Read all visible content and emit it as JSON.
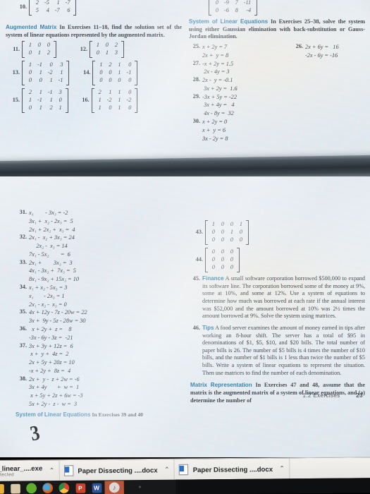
{
  "photo": {
    "description": "photo of a monitor showing a linear algebra textbook page"
  },
  "textbook": {
    "running_head": "1.2   Exercises",
    "page_number": "23",
    "top_matrix_left": {
      "number": "10.",
      "rows": [
        [
          "2",
          "-5",
          "1",
          "-7"
        ],
        [
          "5",
          "4",
          "-7",
          "6"
        ]
      ]
    },
    "top_matrix_right": {
      "rows": [
        [
          "0",
          "-9",
          "7",
          "-11"
        ],
        [
          "0",
          "-6",
          "8",
          "-4"
        ]
      ]
    },
    "sections": {
      "augmented_matrix": {
        "heading": "Augmented Matrix",
        "instruction": "In Exercises 11–18, find the solution set of the system of linear equations represented by the augmented matrix."
      },
      "system_of_linear_equations": {
        "heading": "System of Linear Equations",
        "instruction": "In Exercises 25–38, solve the system using either Gaussian elimination with back-substitution or Gauss-Jordan elimination."
      },
      "matrix_representation": {
        "heading": "Matrix Representation",
        "instruction": "In Exercises 47 and 48, assume that the matrix is the augmented matrix of a system of linear equations, and (a) determine the number of"
      },
      "cut_off_bottom": {
        "heading": "System of Linear Equations",
        "instruction": "In Exercises 39 and 40"
      }
    },
    "matrix_exercises": [
      {
        "number": "11.",
        "rows": [
          [
            "1",
            "0",
            "0"
          ],
          [
            "0",
            "1",
            "2"
          ]
        ]
      },
      {
        "number": "12.",
        "rows": [
          [
            "1",
            "0",
            "2"
          ],
          [
            "0",
            "1",
            "3"
          ]
        ]
      },
      {
        "number": "13.",
        "rows": [
          [
            "1",
            "-1",
            "0",
            "3"
          ],
          [
            "0",
            "1",
            "-2",
            "1"
          ],
          [
            "0",
            "0",
            "1",
            "-1"
          ]
        ]
      },
      {
        "number": "14.",
        "rows": [
          [
            "1",
            "2",
            "1",
            "0"
          ],
          [
            "0",
            "0",
            "1",
            "-1"
          ],
          [
            "0",
            "0",
            "0",
            "0"
          ]
        ]
      },
      {
        "number": "15.",
        "rows": [
          [
            "2",
            "1",
            "-1",
            "3"
          ],
          [
            "1",
            "-1",
            "1",
            "0"
          ],
          [
            "0",
            "1",
            "2",
            "1"
          ]
        ]
      },
      {
        "number": "16.",
        "rows": [
          [
            "2",
            "1",
            "1",
            "0"
          ],
          [
            "1",
            "-2",
            "1",
            "-2"
          ],
          [
            "1",
            "0",
            "1",
            "0"
          ]
        ]
      },
      {
        "number": "43.",
        "rows": [
          [
            "1",
            "0",
            "0",
            "1"
          ],
          [
            "0",
            "0",
            "1",
            "0"
          ],
          [
            "0",
            "0",
            "0",
            "0"
          ]
        ]
      },
      {
        "number": "44.",
        "rows": [
          [
            "0",
            "0",
            "0"
          ],
          [
            "0",
            "0",
            "0"
          ],
          [
            "0",
            "0",
            "0"
          ]
        ]
      }
    ],
    "system_exercises": [
      {
        "number": "25.",
        "equations": [
          "x + 2y = 7",
          "2x +  y = 8"
        ]
      },
      {
        "number": "26.",
        "equations": [
          "2x + 6y =   16",
          "-2x - 6y = -16"
        ]
      },
      {
        "number": "27.",
        "equations": [
          "-x + 2y = 1.5",
          " 2x - 4y = 3"
        ]
      },
      {
        "number": "28.",
        "equations": [
          "2x -  y = -0.1",
          " 3x + 2y =  1.6"
        ]
      },
      {
        "number": "29.",
        "equations": [
          "-3x + 5y = -22",
          " 3x + 4y =   4",
          " 4x - 8y =  32"
        ]
      },
      {
        "number": "30.",
        "equations": [
          "x + 2y = 0",
          "x +  y = 6",
          "3x - 2y = 8"
        ]
      },
      {
        "number": "31.",
        "equations": [
          "x₁        - 3x₃ = -2",
          "3x₁ +  x₂ - 2x₃ =  5",
          "2x₁ + 2x₂ +  x₃ =  4"
        ]
      },
      {
        "number": "32.",
        "equations": [
          "2x₁ -  x₂ + 3x₃ = 24",
          "     2x₂ -  x₃ = 14",
          "7x₁ - 5x₂        =  6"
        ]
      },
      {
        "number": "33.",
        "equations": [
          "2x₁ +        3x₃ =  3",
          "4x₁ - 3x₂ +  7x₃ =  5",
          "8x₁ - 9x₂ + 15x₃ = 10"
        ]
      },
      {
        "number": "34.",
        "equations": [
          "x₁ + x₂ - 5x₃ = 3",
          "x₁       - 2x₃ = 1",
          "2x₁ - x₂ -  x₃ = 0"
        ]
      },
      {
        "number": "35.",
        "equations": [
          "4x + 12y - 7z - 20w = 22",
          "3x +  9y - 5z - 28w = 30"
        ]
      },
      {
        "number": "36.",
        "equations": [
          "  x + 2y +  z =    8",
          "-3x - 6y - 3z =  -21"
        ]
      },
      {
        "number": "37.",
        "equations": [
          "3x + 3y + 12z =  6",
          " x +  y +  4z =  2",
          "2x + 5y + 20z = 10",
          "-x + 2y +  8z =  4"
        ]
      },
      {
        "number": "38.",
        "equations": [
          "2x +  y -  z + 2w = -6",
          "3x + 4y       +  w =  1",
          " x + 5y + 2z + 6w = -3",
          "5x + 2y -  z -  w =  3"
        ]
      }
    ],
    "word_exercises": [
      {
        "number": "45.",
        "label": "Finance",
        "body": "A small software corporation borrowed $500,000 to expand its software line. The corporation borrowed some of the money at 9%, some at 10%, and some at 12%. Use a system of equations to determine how much was borrowed at each rate if the annual interest was $52,000 and the amount borrowed at 10% was 2½ times the amount borrowed at 9%. Solve the system using matrices."
      },
      {
        "number": "46.",
        "label": "Tips",
        "body": "A food server examines the amount of money earned in tips after working an 8-hour shift. The server has a total of $95 in denominations of $1, $5, $10, and $20 bills. The total number of paper bills is 26. The number of $5 bills is 4 times the number of $10 bills, and the number of $1 bills is 1 less than twice the number of $5 bills. Write a system of linear equations to represent the situation. Then use matrices to find the number of each denomination."
      }
    ],
    "annotations": [
      {
        "name": "circled-exercise-34",
        "value": "34"
      },
      {
        "name": "handwritten-mark-exercise-32",
        "value": "3"
      }
    ]
  },
  "download_bar": {
    "items": [
      {
        "name": "y_linear_....exe",
        "status": "detected",
        "caret": "⌃"
      },
      {
        "name": "Paper Dissecting ....docx",
        "caret": "⌃"
      },
      {
        "name": "Paper Dissecting ....docx",
        "caret": "⌃"
      }
    ]
  },
  "taskbar": {
    "icons": [
      {
        "name": "file-explorer-icon",
        "color": "#e8b23a",
        "glyph": ""
      },
      {
        "name": "app-icon-cat",
        "color": "#d8c9a8",
        "glyph": ""
      },
      {
        "name": "app-icon-green-circle",
        "color": "#5fae2e",
        "glyph": ""
      },
      {
        "name": "firefox-icon",
        "color": "#e66000",
        "glyph": ""
      },
      {
        "name": "chrome-icon",
        "color": "#d94235",
        "glyph": ""
      },
      {
        "name": "powerpoint-icon",
        "color": "#c8452a",
        "glyph": "P"
      },
      {
        "name": "word-icon",
        "color": "#2a5699",
        "glyph": "W"
      },
      {
        "name": "itunes-icon",
        "color": "#b8372e",
        "glyph": "♪"
      }
    ]
  }
}
